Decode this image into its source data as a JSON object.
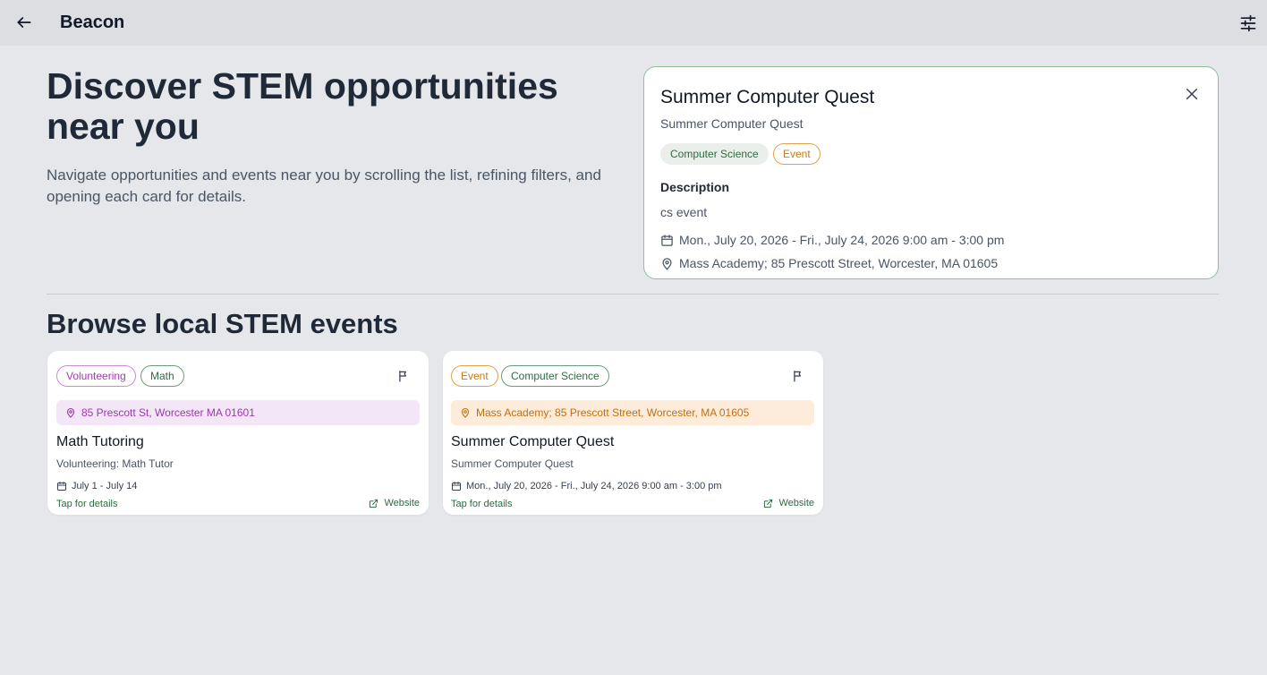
{
  "appbar": {
    "title": "Beacon",
    "back_icon": "arrow-left-icon",
    "filter_icon": "sliders-icon"
  },
  "hero": {
    "title": "Discover STEM opportunities near you",
    "subtitle": "Navigate opportunities and events near you by scrolling the list, refining filters, and opening each card for details."
  },
  "detail": {
    "title": "Summer Computer Quest",
    "subtitle": "Summer Computer Quest",
    "tags": [
      "Computer Science",
      "Event"
    ],
    "description_label": "Description",
    "description": "cs event",
    "date": "Mon., July 20, 2026 - Fri., July 24, 2026 9:00 am - 3:00 pm",
    "location": "Mass Academy; 85 Prescott Street, Worcester, MA 01605"
  },
  "browse": {
    "title": "Browse local STEM events",
    "cards": [
      {
        "tags": [
          "Volunteering",
          "Math"
        ],
        "location": "85 Prescott St, Worcester MA 01601",
        "title": "Math Tutoring",
        "subtitle": "Volunteering: Math Tutor",
        "date": "July 1 - July 14",
        "tap_label": "Tap for details",
        "website_label": "Website"
      },
      {
        "tags": [
          "Event",
          "Computer Science"
        ],
        "location": "Mass Academy; 85 Prescott Street, Worcester, MA 01605",
        "title": "Summer Computer Quest",
        "subtitle": "Summer Computer Quest",
        "date": "Mon., July 20, 2026 - Fri., July 24, 2026 9:00 am - 3:00 pm",
        "tap_label": "Tap for details",
        "website_label": "Website"
      }
    ]
  },
  "colors": {
    "accent_green": "#2e6b41",
    "event_orange": "#c77b15",
    "volunteer_purple": "#a03bb5"
  }
}
